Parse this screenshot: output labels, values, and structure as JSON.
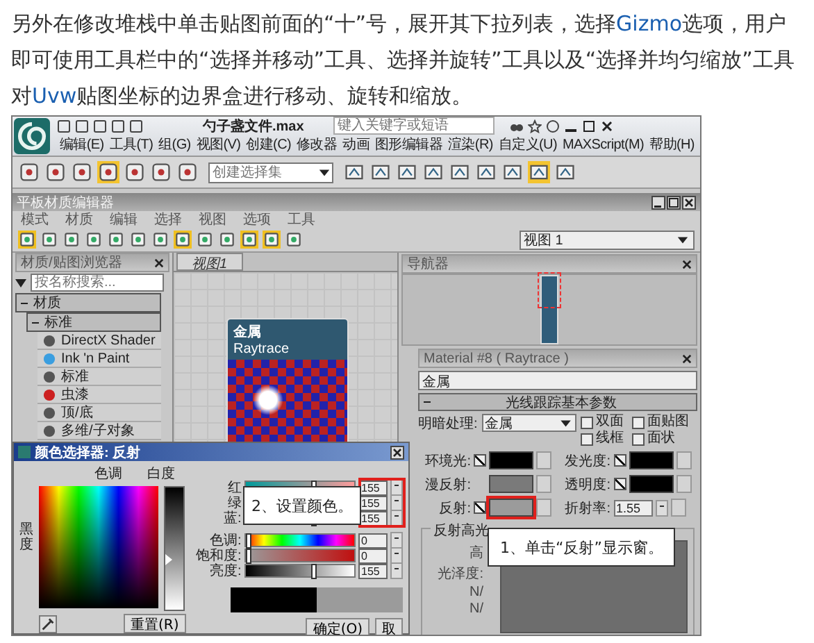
{
  "article": {
    "parts": [
      {
        "kind": "text",
        "text": "另外在修改堆栈中单击贴图前面的“十”号，展开其下拉列表，选择"
      },
      {
        "kind": "term",
        "text": "Gizmo"
      },
      {
        "kind": "text",
        "text": "选项，用户即可使用工具栏中的“选择并移动”工具、选择并旋转”工具以及“选择并均匀缩放”工具对"
      },
      {
        "kind": "term",
        "text": "Uvw"
      },
      {
        "kind": "text",
        "text": "贴图坐标的边界盒进行移动、旋转和缩放。"
      }
    ]
  },
  "max": {
    "title": "勺子盏文件.max",
    "search": {
      "placeholder": "键入关键字或短语"
    },
    "menu": [
      "编辑(E)",
      "工具(T)",
      "组(G)",
      "视图(V)",
      "创建(C)",
      "修改器",
      "动画",
      "图形编辑器",
      "渲染(R)",
      "自定义(U)",
      "MAXScript(M)",
      "帮助(H)"
    ],
    "selection_set": {
      "placeholder": "创建选择集"
    }
  },
  "slate": {
    "title": "平板材质编辑器",
    "menu": [
      "模式",
      "材质",
      "编辑",
      "选择",
      "视图",
      "选项",
      "工具"
    ],
    "browser": {
      "title": "材质/贴图浏览器",
      "search": {
        "placeholder": "按名称搜索..."
      },
      "tree": [
        {
          "label": "材质",
          "expanded": true,
          "children": [
            {
              "label": "标准",
              "expanded": true,
              "children": [
                {
                  "label": "DirectX Shader",
                  "color": "#555555"
                },
                {
                  "label": "Ink 'n Paint",
                  "color": "#3a9ee0"
                },
                {
                  "label": "标准",
                  "color": "#555555"
                },
                {
                  "label": "虫漆",
                  "color": "#cc2020"
                },
                {
                  "label": "顶/底",
                  "color": "#555555"
                },
                {
                  "label": "多维/子对象",
                  "color": "#555555"
                }
              ]
            }
          ]
        }
      ]
    },
    "view_tab": {
      "label": "视图1",
      "selected": true
    },
    "node": {
      "title": "金属",
      "subtitle": "Raytrace"
    },
    "view_select": {
      "value": "视图 1"
    },
    "navigator": {
      "title": "导航器"
    },
    "material": {
      "title": "Material #8 ( Raytrace )",
      "name": "金属",
      "rollout": {
        "title": "光线跟踪基本参数",
        "expanded": true
      },
      "shading": {
        "label": "明暗处理:",
        "value": "金属"
      },
      "options": [
        {
          "label": "双面",
          "checked": false
        },
        {
          "label": "面贴图",
          "checked": false
        },
        {
          "label": "线框",
          "checked": false
        },
        {
          "label": "面状",
          "checked": false
        }
      ],
      "swatches": [
        {
          "kind": "check_swatch",
          "label": "环境光:",
          "checked": true,
          "color": "#000000",
          "highlighted": false
        },
        {
          "kind": "check_swatch",
          "label": "发光度:",
          "checked": true,
          "color": "#000000",
          "highlighted": false
        },
        {
          "kind": "swatch",
          "label": "漫反射:",
          "color": "#7a7a7a",
          "highlighted": false
        },
        {
          "kind": "check_swatch",
          "label": "透明度:",
          "checked": true,
          "color": "#000000",
          "highlighted": false
        },
        {
          "kind": "check_swatch",
          "label": "反射:",
          "checked": true,
          "color": "#9b9b9b",
          "highlighted": true
        },
        {
          "kind": "spinner",
          "label": "折射率:",
          "value": "1.55"
        }
      ],
      "specular": {
        "title": "反射高光",
        "labels": [
          "高",
          "光泽度:",
          "N/",
          "N/"
        ]
      },
      "callout": "1、单击“反射”显示窗。"
    }
  },
  "color_picker": {
    "title": "颜色选择器: 反射",
    "hue_label": "色调",
    "white_label": "白度",
    "black_label": "黑度",
    "channels": [
      {
        "kind": "red",
        "label": "红",
        "value": "155",
        "level": 0.61
      },
      {
        "kind": "green",
        "label": "绿",
        "value": "155",
        "level": 0.61
      },
      {
        "kind": "blue",
        "label": "蓝:",
        "value": "155",
        "level": 0.61
      }
    ],
    "hsv": [
      {
        "kind": "hue",
        "label": "色调:",
        "value": "0",
        "level": 0
      },
      {
        "kind": "sat",
        "label": "饱和度:",
        "value": "0",
        "level": 0
      },
      {
        "kind": "val",
        "label": "亮度:",
        "value": "155",
        "level": 0.61
      }
    ],
    "whiteness": {
      "level": 0.41
    },
    "reset_button": "重置(R)",
    "ok_button": "确定(O)",
    "cancel_button": "取",
    "callout": "2、设置颜色。"
  }
}
